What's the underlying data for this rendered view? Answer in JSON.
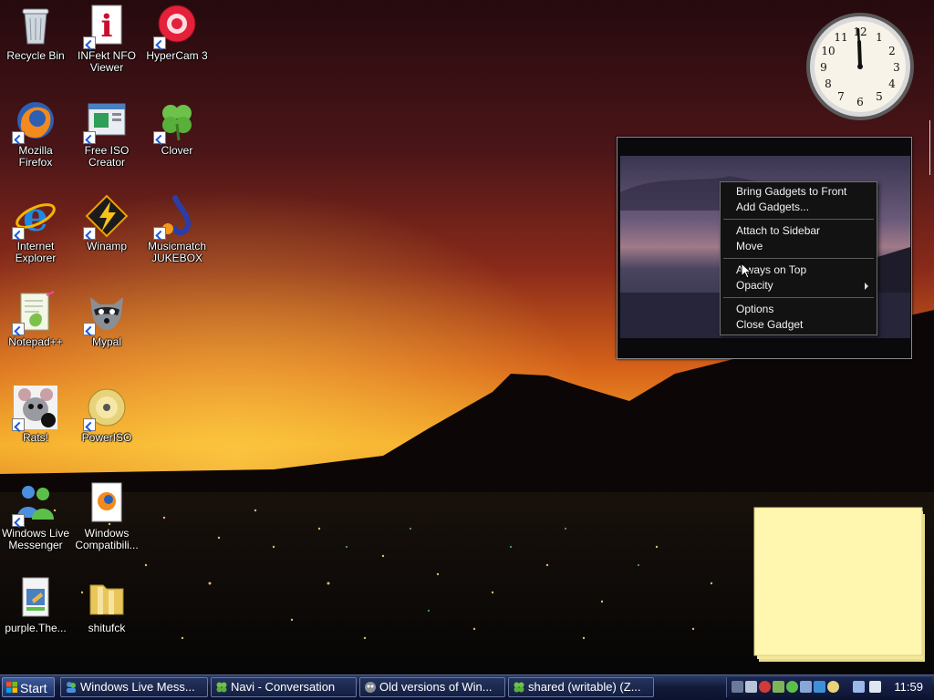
{
  "desktop": {
    "icons": [
      {
        "label": "Recycle Bin",
        "icon": "recycle-bin-icon"
      },
      {
        "label": "INFekt NFO\nViewer",
        "icon": "infekt-icon"
      },
      {
        "label": "HyperCam 3",
        "icon": "hypercam-icon"
      },
      {
        "label": "Mozilla\nFirefox",
        "icon": "firefox-icon"
      },
      {
        "label": "Free ISO\nCreator",
        "icon": "free-iso-creator-icon"
      },
      {
        "label": "Clover",
        "icon": "clover-icon"
      },
      {
        "label": "Internet\nExplorer",
        "icon": "internet-explorer-icon"
      },
      {
        "label": "Winamp",
        "icon": "winamp-icon"
      },
      {
        "label": "Musicmatch\nJUKEBOX",
        "icon": "musicmatch-icon"
      },
      {
        "label": "Notepad++",
        "icon": "notepad-plus-plus-icon"
      },
      {
        "label": "Mypal",
        "icon": "mypal-icon"
      },
      {
        "label": "Rats!",
        "icon": "rats-icon"
      },
      {
        "label": "PowerISO",
        "icon": "poweriso-icon"
      },
      {
        "label": "Windows Live\nMessenger",
        "icon": "windows-live-messenger-icon"
      },
      {
        "label": "Windows\nCompatibili...",
        "icon": "windows-compatibility-icon"
      },
      {
        "label": "purple.The...",
        "icon": "purple-file-icon"
      },
      {
        "label": "shitufck",
        "icon": "folder-icon"
      }
    ]
  },
  "clock_gadget": {
    "numerals": [
      "12",
      "1",
      "2",
      "3",
      "4",
      "5",
      "6",
      "7",
      "8",
      "9",
      "10",
      "11"
    ]
  },
  "context_menu": {
    "groups": [
      [
        "Bring Gadgets to Front",
        "Add Gadgets..."
      ],
      [
        "Attach to Sidebar",
        "Move"
      ],
      [
        "Always on Top",
        "Opacity"
      ],
      [
        "Options",
        "Close Gadget"
      ]
    ],
    "submenu_item": "Opacity"
  },
  "taskbar": {
    "start_label": "Start",
    "tasks": [
      {
        "label": "Windows Live Mess...",
        "icon": "messenger-task-icon"
      },
      {
        "label": "Navi - Conversation",
        "icon": "clover-task-icon"
      },
      {
        "label": "Old versions of Win...",
        "icon": "browser-task-icon"
      },
      {
        "label": "shared (writable) (Z...",
        "icon": "clover-task-icon"
      }
    ],
    "tray_icons": [
      "network-icon",
      "security-icon",
      "shield-icon",
      "plugin-icon",
      "messenger-tray-icon",
      "sync-icon",
      "media-icon",
      "disc-icon",
      "display-icon",
      "volume-icon"
    ],
    "clock": "11:59"
  },
  "colors": {
    "taskbar": "#121b3a",
    "menu_bg": "#121212",
    "sticky_note": "#fff7b0",
    "sky_top": "#2a0c10",
    "sky_horizon": "#f5b020"
  }
}
